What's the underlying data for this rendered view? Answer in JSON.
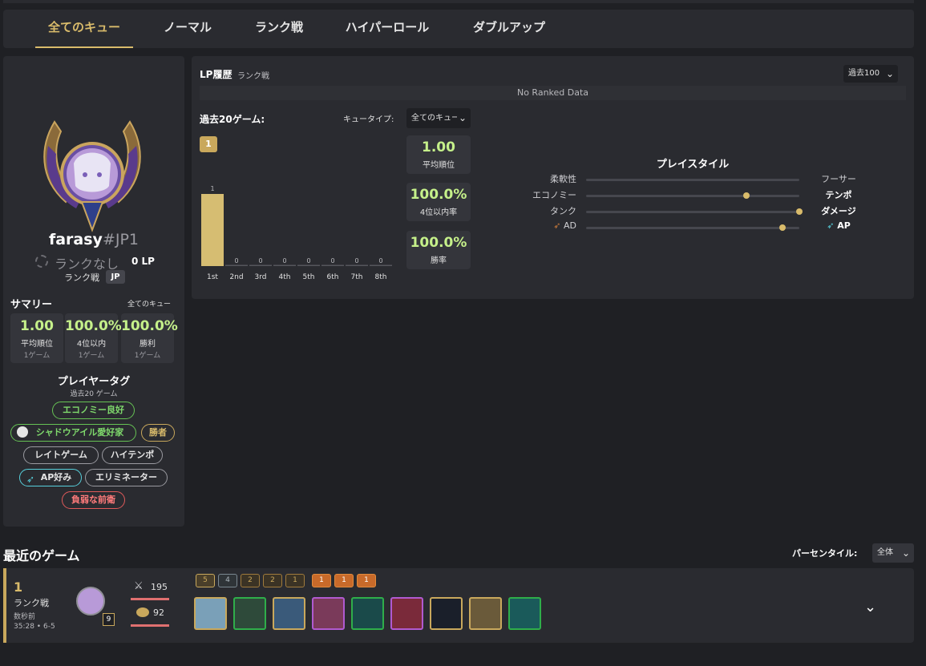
{
  "tabs": [
    "全てのキュー",
    "ノーマル",
    "ランク戦",
    "ハイパーロール",
    "ダブルアップ"
  ],
  "profile": {
    "name": "farasy",
    "tag": "#JP1",
    "rank": "ランクなし",
    "lp": "0 LP",
    "queue": "ランク戦",
    "region": "JP",
    "summary_title": "サマリー",
    "summary_filter": "全てのキュー",
    "stats": [
      {
        "value": "1.00",
        "label": "平均順位",
        "sub": "1ゲーム"
      },
      {
        "value": "100.0%",
        "label": "4位以内",
        "sub": "1ゲーム"
      },
      {
        "value": "100.0%",
        "label": "勝利",
        "sub": "1ゲーム"
      }
    ],
    "tags_title": "プレイヤータグ",
    "tags_sub": "過去20 ゲーム",
    "tags": [
      "エコノミー良好",
      "シャドウアイル愛好家",
      "勝者",
      "レイトゲーム",
      "ハイテンポ",
      "AP好み",
      "エリミネーター",
      "負弱な前衛"
    ],
    "level": "9"
  },
  "lp_history": {
    "title": "LP履歴",
    "subtitle": "ランク戦",
    "range": "過去100",
    "empty": "No Ranked Data"
  },
  "last20": {
    "title": "過去20ゲーム:",
    "queue_label": "キュータイプ:",
    "queue_value": "全てのキュー",
    "badge": "1",
    "cards": [
      {
        "value": "1.00",
        "label": "平均順位"
      },
      {
        "value": "100.0%",
        "label": "4位以内率"
      },
      {
        "value": "100.0%",
        "label": "勝率"
      }
    ]
  },
  "chart_data": {
    "type": "bar",
    "categories": [
      "1st",
      "2nd",
      "3rd",
      "4th",
      "5th",
      "6th",
      "7th",
      "8th"
    ],
    "values": [
      1,
      0,
      0,
      0,
      0,
      0,
      0,
      0
    ],
    "ylim": [
      0,
      1
    ]
  },
  "playstyle": {
    "title": "プレイスタイル",
    "rows": [
      {
        "left": "柔軟性",
        "right": "フーサー",
        "level": null
      },
      {
        "left": "エコノミー",
        "right": "テンポ",
        "level": 0.75
      },
      {
        "left": "タンク",
        "right": "ダメージ",
        "level": 1.0
      },
      {
        "left": "AD",
        "right": "AP",
        "level": 0.92
      }
    ]
  },
  "recent": {
    "title": "最近のゲーム",
    "percentile_label": "パーセンタイル:",
    "percentile_value": "全体",
    "game": {
      "place": "1",
      "queue": "ランク戦",
      "when": "数秒前",
      "meta": "35:28 • 6-5",
      "damage": "195",
      "gold": "92",
      "traits": [
        "5",
        "4",
        "2",
        "2",
        "1",
        "1",
        "1",
        "1"
      ]
    }
  },
  "colors": {
    "accent": "#d9bb6b",
    "positive": "#c5f08a",
    "panel": "#2a2b30",
    "bg": "#1f2024"
  }
}
